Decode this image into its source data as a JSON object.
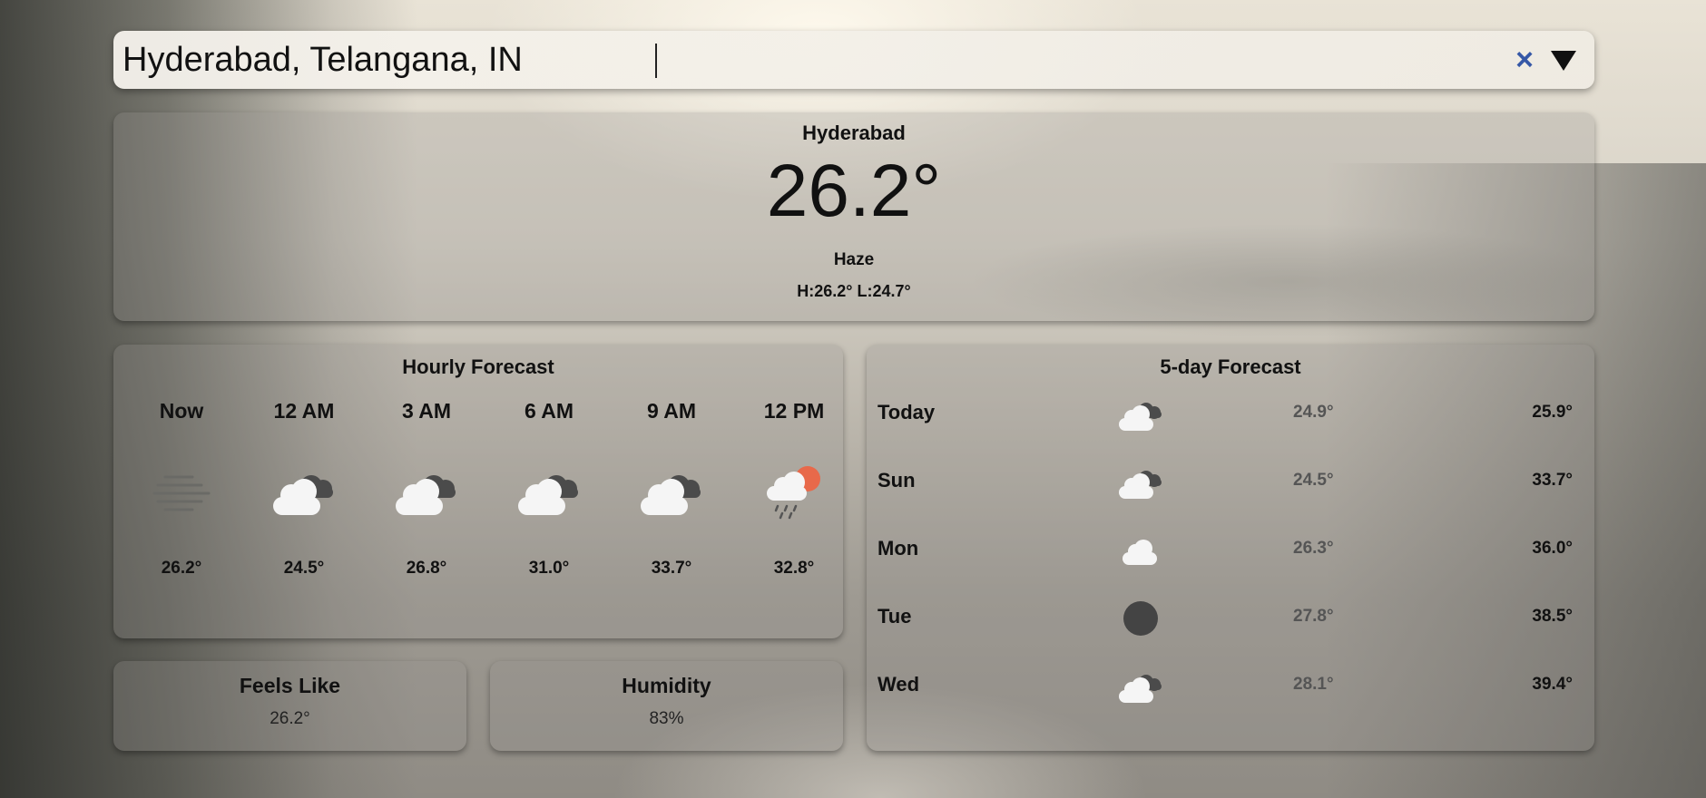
{
  "search": {
    "value": "Hyderabad, Telangana, IN",
    "clear_glyph": "×",
    "dropdown_icon": "triangle-down-icon",
    "accent_color": "#3557a6"
  },
  "current": {
    "city": "Hyderabad",
    "temperature": "26.2°",
    "condition": "Haze",
    "high_low": "H:26.2° L:24.7°"
  },
  "hourly": {
    "title": "Hourly Forecast",
    "items": [
      {
        "time": "Now",
        "icon": "haze-icon",
        "temp": "26.2°"
      },
      {
        "time": "12 AM",
        "icon": "broken-clouds-icon",
        "temp": "24.5°"
      },
      {
        "time": "3 AM",
        "icon": "broken-clouds-icon",
        "temp": "26.8°"
      },
      {
        "time": "6 AM",
        "icon": "broken-clouds-icon",
        "temp": "31.0°"
      },
      {
        "time": "9 AM",
        "icon": "broken-clouds-icon",
        "temp": "33.7°"
      },
      {
        "time": "12 PM",
        "icon": "sun-rain-cloud-icon",
        "temp": "32.8°"
      }
    ]
  },
  "daily": {
    "title": "5-day Forecast",
    "items": [
      {
        "day": "Today",
        "icon": "broken-clouds-icon",
        "low": "24.9°",
        "high": "25.9°"
      },
      {
        "day": "Sun",
        "icon": "broken-clouds-icon",
        "low": "24.5°",
        "high": "33.7°"
      },
      {
        "day": "Mon",
        "icon": "cloud-icon",
        "low": "26.3°",
        "high": "36.0°"
      },
      {
        "day": "Tue",
        "icon": "dark-circle-icon",
        "low": "27.8°",
        "high": "38.5°"
      },
      {
        "day": "Wed",
        "icon": "broken-clouds-icon",
        "low": "28.1°",
        "high": "39.4°"
      }
    ]
  },
  "feels_like": {
    "title": "Feels Like",
    "value": "26.2°"
  },
  "humidity": {
    "title": "Humidity",
    "value": "83%"
  }
}
